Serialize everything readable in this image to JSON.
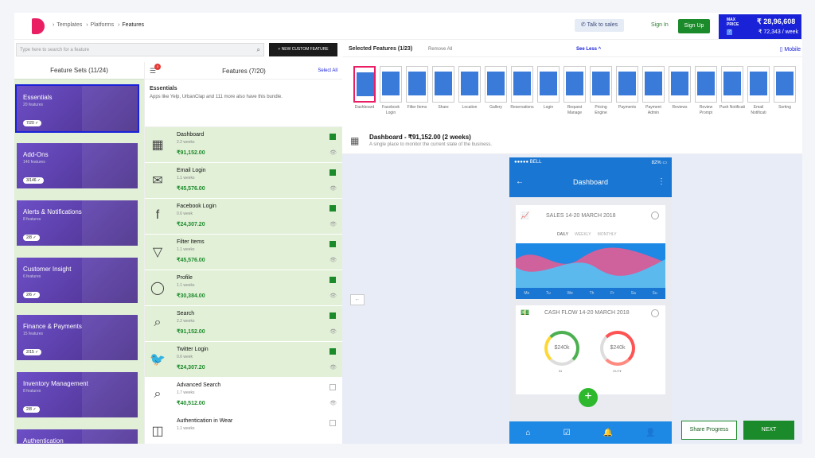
{
  "header": {
    "breadcrumb": [
      "Templates",
      "Platforms",
      "Features"
    ],
    "talk_to_sales": "Talk to sales",
    "sign_in": "Sign In",
    "sign_up": "Sign Up",
    "max_price_label": "MAX PRICE",
    "max_price_total": "₹ 28,96,608",
    "max_price_week": "₹ 72,343 / week",
    "info": "?"
  },
  "search": {
    "placeholder": "Type here to search for a feature",
    "new_custom": "+ NEW CUSTOM FEATURE"
  },
  "feature_sets": {
    "title": "Feature Sets (11/24)",
    "items": [
      {
        "name": "Essentials",
        "count": "20 features",
        "pill": "7/20 ✓"
      },
      {
        "name": "Add-Ons",
        "count": "146 features",
        "pill": "3/146 ✓"
      },
      {
        "name": "Alerts & Notifications",
        "count": "8 features",
        "pill": "2/8 ✓"
      },
      {
        "name": "Customer Insight",
        "count": "6 features",
        "pill": "2/6 ✓"
      },
      {
        "name": "Finance & Payments",
        "count": "15 features",
        "pill": "2/15 ✓"
      },
      {
        "name": "Inventory Management",
        "count": "8 features",
        "pill": "2/8 ✓"
      },
      {
        "name": "Authentication",
        "count": "",
        "pill": ""
      }
    ]
  },
  "features": {
    "title": "Features (7/20)",
    "select_all": "Select All",
    "filter_badge": "0",
    "bundle_title": "Essentials",
    "bundle_desc": "Apps like Yelp, UrbanClap and 111 more also have this bundle.",
    "rows": [
      {
        "name": "Dashboard",
        "weeks": "2.2 weeks",
        "price": "₹91,152.00",
        "icon": "▦",
        "on": true
      },
      {
        "name": "Email Login",
        "weeks": "1.1 weeks",
        "price": "₹45,576.00",
        "icon": "✉",
        "on": true
      },
      {
        "name": "Facebook Login",
        "weeks": "0.6 week",
        "price": "₹24,307.20",
        "icon": "f",
        "on": true
      },
      {
        "name": "Filter Items",
        "weeks": "1.1 weeks",
        "price": "₹45,576.00",
        "icon": "▽",
        "on": true
      },
      {
        "name": "Profile",
        "weeks": "1.1 weeks",
        "price": "₹30,384.00",
        "icon": "◯",
        "on": true
      },
      {
        "name": "Search",
        "weeks": "2.2 weeks",
        "price": "₹91,152.00",
        "icon": "⌕",
        "on": true
      },
      {
        "name": "Twitter Login",
        "weeks": "0.6 week",
        "price": "₹24,307.20",
        "icon": "🐦",
        "on": true
      },
      {
        "name": "Advanced Search",
        "weeks": "1.7 weeks",
        "price": "₹40,512.00",
        "icon": "⌕",
        "on": false
      },
      {
        "name": "Authentication in Wear",
        "weeks": "1.1 weeks",
        "price": "",
        "icon": "◫",
        "on": false
      }
    ]
  },
  "selected": {
    "title": "Selected Features (1/23)",
    "remove_all": "Remove All",
    "see_less": "See Less ^",
    "mobile": "▯ Mobile",
    "thumbs": [
      "Dashboard",
      "Facebook Login",
      "Filter Items",
      "Share",
      "Location",
      "Gallery",
      "Reservations",
      "Login",
      "Request Manage",
      "Pricing Engine",
      "Payments",
      "Payment Admin",
      "Reviews",
      "Review Prompt",
      "Push Notificati",
      "Email Notificati",
      "Sorting"
    ]
  },
  "detail": {
    "title": "Dashboard - ₹91,152.00 (2 weeks)",
    "subtitle": "A single place to monitor the current state of the business."
  },
  "phone": {
    "carrier": "●●●●● BELL",
    "battery": "82% ▭",
    "nav_title": "Dashboard",
    "sales_title": "SALES 14-20 MARCH 2018",
    "tabs": [
      "DAILY",
      "WEEKLY",
      "MONTHLY"
    ],
    "days": [
      "Mo",
      "Tu",
      "We",
      "Th",
      "Fr",
      "Sa",
      "Su"
    ],
    "cash_title": "CASH FLOW 14-20 MARCH 2018",
    "in_value": "$240k",
    "out_value": "$240k",
    "in_label": "IN",
    "out_label": "OUT▾"
  },
  "footer": {
    "share": "Share Progress",
    "next": "NEXT"
  }
}
